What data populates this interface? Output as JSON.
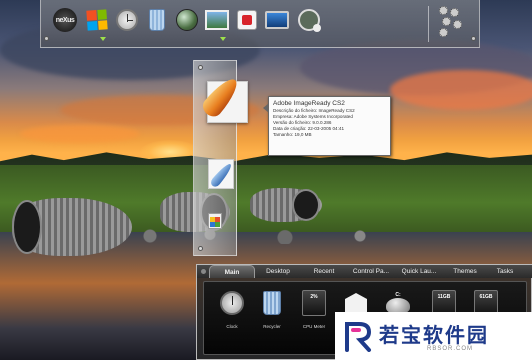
{
  "top_dock": {
    "items": [
      {
        "name": "Nexus",
        "icon": "nexus-logo-icon",
        "label": "neXus"
      },
      {
        "name": "Windows",
        "icon": "windows-logo-icon"
      },
      {
        "name": "Clock",
        "icon": "clock-icon"
      },
      {
        "name": "Recycler",
        "icon": "recycle-bin-icon"
      },
      {
        "name": "Internet",
        "icon": "globe-icon"
      },
      {
        "name": "Pictures",
        "icon": "photo-icon"
      },
      {
        "name": "Store",
        "icon": "red-box-icon"
      },
      {
        "name": "Display",
        "icon": "monitor-icon"
      },
      {
        "name": "Gadget",
        "icon": "gadget-icon"
      },
      {
        "name": "Settings",
        "icon": "gear-cluster-icon"
      }
    ],
    "indicator_color": "#9ee14a"
  },
  "vertical_dock": {
    "items": [
      {
        "name": "Adobe ImageReady CS2",
        "icon": "imageready-feather-icon"
      },
      {
        "name": "Adobe Photoshop",
        "icon": "photoshop-feather-icon"
      },
      {
        "name": "Microsoft Office",
        "icon": "office-icon"
      }
    ]
  },
  "tooltip": {
    "title": "Adobe ImageReady CS2",
    "lines": [
      "Descrição do ficheiro: ImageReady CS2",
      "Empresa: Adobe Systems Incorporated",
      "Versão do ficheiro: 9.0.0.286",
      "Data de criação: 22-03-2005 04:41",
      "Tamanho: 19,0 MB"
    ]
  },
  "bottom_panel": {
    "tabs": [
      {
        "label": "Main",
        "active": true
      },
      {
        "label": "Desktop",
        "active": false
      },
      {
        "label": "Recent",
        "active": false
      },
      {
        "label": "Control Pa...",
        "active": false
      },
      {
        "label": "Quick Lau...",
        "active": false
      },
      {
        "label": "Themes",
        "active": false
      },
      {
        "label": "Tasks",
        "active": false
      }
    ],
    "items": [
      {
        "label": "Clock",
        "icon": "clock-icon"
      },
      {
        "label": "Recycler",
        "icon": "recycle-bin-icon"
      },
      {
        "label": "CPU Meter",
        "icon": "cpu-meter-icon",
        "value": "2%"
      },
      {
        "label": "",
        "icon": "mail-icon"
      },
      {
        "label": "",
        "icon": "drive-icon",
        "value": "C:"
      },
      {
        "label": "",
        "icon": "drive-capacity-icon",
        "value": "11GB"
      },
      {
        "label": "",
        "icon": "drive-capacity-icon",
        "value": "61GB"
      }
    ]
  },
  "watermark": {
    "text": "若宝软件园",
    "subtext": "RBSOR.COM",
    "color": "#1e3a8a",
    "accent": "#e6339a"
  }
}
